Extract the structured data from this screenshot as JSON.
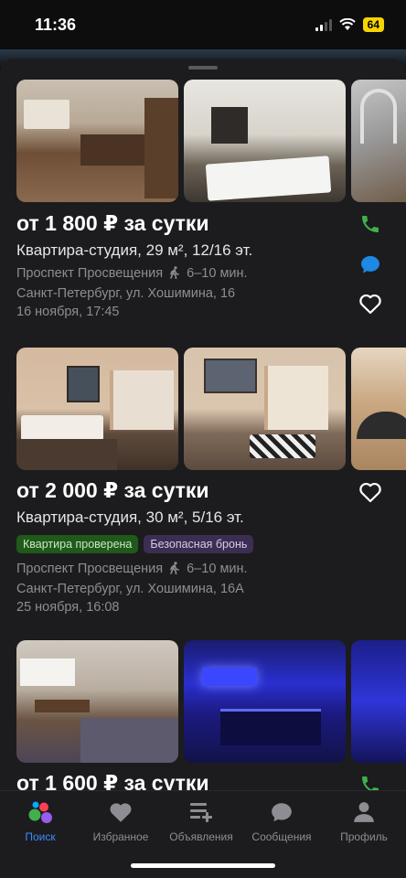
{
  "status": {
    "time": "11:36",
    "battery": "64"
  },
  "listings": [
    {
      "price": "от 1 800 ₽ за сутки",
      "subtitle": "Квартира-студия, 29 м², 12/16 эт.",
      "metro": "Проспект Просвещения",
      "walk": "6–10 мин.",
      "address": "Санкт-Петербург, ул. Хошимина, 16",
      "date": "16 ноября, 17:45",
      "actions": [
        "phone-icon",
        "chat-icon",
        "heart-icon"
      ]
    },
    {
      "price": "от 2 000 ₽ за сутки",
      "subtitle": "Квартира-студия, 30 м², 5/16 эт.",
      "badges": [
        "Квартира проверена",
        "Безопасная бронь"
      ],
      "metro": "Проспект Просвещения",
      "walk": "6–10 мин.",
      "address": "Санкт-Петербург, ул. Хошимина, 16А",
      "date": "25 ноября, 16:08",
      "actions": [
        "heart-icon"
      ]
    },
    {
      "price": "от 1 600 ₽ за сутки",
      "actions": [
        "phone-icon"
      ]
    }
  ],
  "tabbar": {
    "items": [
      {
        "label": "Поиск",
        "icon": "search-dots-icon",
        "active": true
      },
      {
        "label": "Избранное",
        "icon": "heart-icon"
      },
      {
        "label": "Объявления",
        "icon": "list-plus-icon"
      },
      {
        "label": "Сообщения",
        "icon": "chat-bubble-icon"
      },
      {
        "label": "Профиль",
        "icon": "person-icon"
      }
    ]
  },
  "colors": {
    "background": "#1c1c1e",
    "accent_blue": "#3d8cff",
    "phone_green": "#3fb04c",
    "badge_green": "#1f5a1a",
    "badge_purple": "#3b2e52"
  }
}
